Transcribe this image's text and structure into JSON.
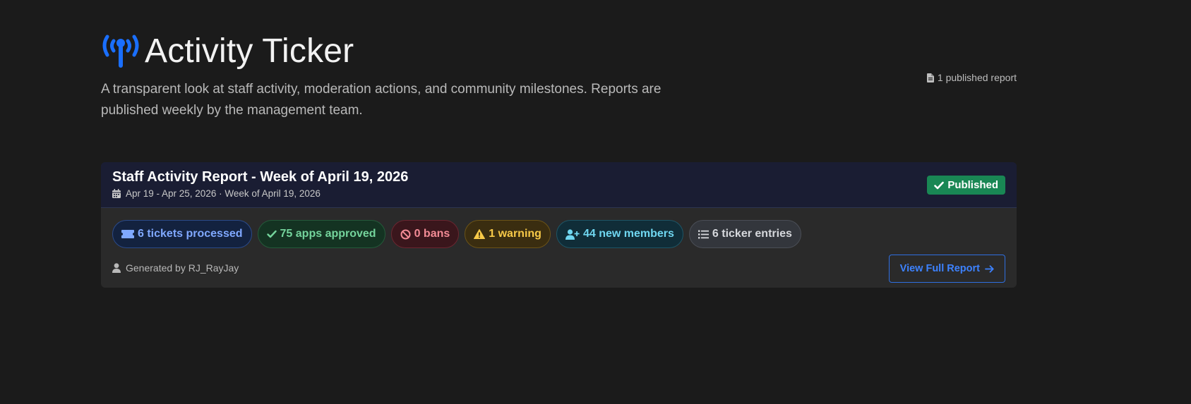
{
  "header": {
    "title": "Activity Ticker",
    "subtitle": "A transparent look at staff activity, moderation actions, and community milestones. Reports are published weekly by the management team.",
    "report_count": "1 published report"
  },
  "report": {
    "title": "Staff Activity Report - Week of April 19, 2026",
    "dates": "Apr 19 - Apr 25, 2026 · Week of April 19, 2026",
    "status": "Published",
    "stats": [
      {
        "label": "6 tickets processed",
        "icon": "ticket-icon"
      },
      {
        "label": "75 apps approved",
        "icon": "check-icon"
      },
      {
        "label": "0 bans",
        "icon": "ban-icon"
      },
      {
        "label": "1 warning",
        "icon": "warning-icon"
      },
      {
        "label": "44 new members",
        "icon": "user-plus-icon"
      },
      {
        "label": "6 ticker entries",
        "icon": "list-icon"
      }
    ],
    "generated_by": "Generated by RJ_RayJay",
    "view_button": "View Full Report"
  },
  "colors": {
    "background": "#1b1b1b",
    "accent": "#0d6efd",
    "published": "#198754"
  }
}
